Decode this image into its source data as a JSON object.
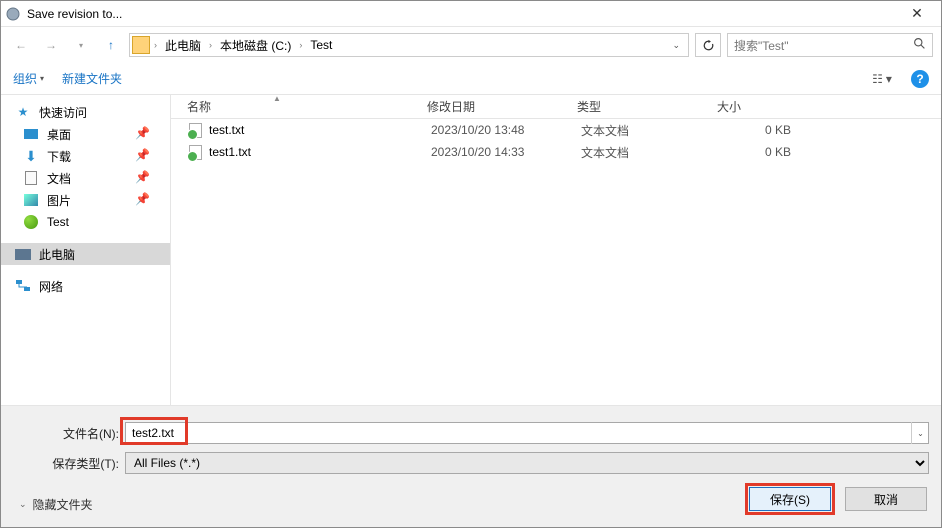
{
  "window": {
    "title": "Save revision to..."
  },
  "nav": {
    "crumbs": [
      "此电脑",
      "本地磁盘 (C:)",
      "Test"
    ],
    "search_placeholder": "搜索\"Test\""
  },
  "toolbar": {
    "organize": "组织",
    "new_folder": "新建文件夹"
  },
  "sidebar": {
    "quick_access": "快速访问",
    "items": [
      {
        "label": "桌面",
        "pinned": true
      },
      {
        "label": "下载",
        "pinned": true
      },
      {
        "label": "文档",
        "pinned": true
      },
      {
        "label": "图片",
        "pinned": true
      },
      {
        "label": "Test",
        "pinned": false
      }
    ],
    "this_pc": "此电脑",
    "network": "网络"
  },
  "columns": {
    "name": "名称",
    "date": "修改日期",
    "type": "类型",
    "size": "大小"
  },
  "files": [
    {
      "name": "test.txt",
      "date": "2023/10/20 13:48",
      "type": "文本文档",
      "size": "0 KB"
    },
    {
      "name": "test1.txt",
      "date": "2023/10/20 14:33",
      "type": "文本文档",
      "size": "0 KB"
    }
  ],
  "footer": {
    "filename_label": "文件名(N):",
    "filename_value": "test2.txt",
    "filetype_label": "保存类型(T):",
    "filetype_value": "All Files (*.*)",
    "hide_folders": "隐藏文件夹",
    "save": "保存(S)",
    "cancel": "取消"
  }
}
